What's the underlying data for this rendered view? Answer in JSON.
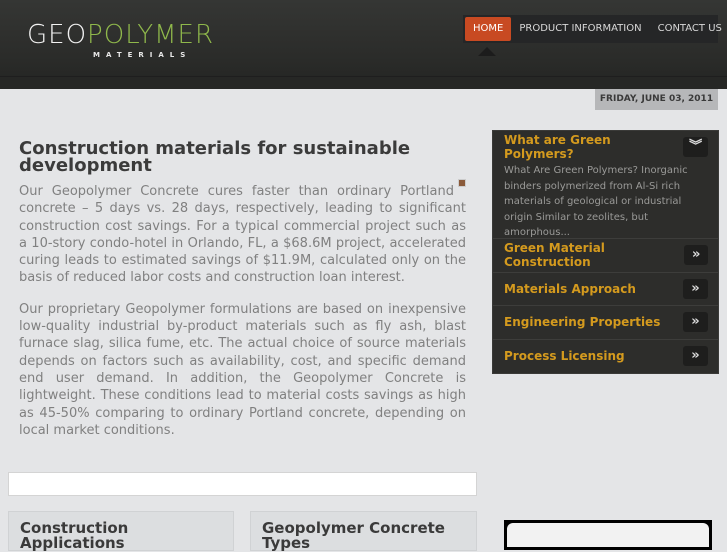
{
  "logo": {
    "geo": "GEO",
    "polymer": "POLYMER",
    "materials": "MATERIALS"
  },
  "nav": {
    "items": [
      "HOME",
      "PRODUCT INFORMATION",
      "CONTACT US"
    ]
  },
  "date": "FRIDAY, JUNE 03, 2011",
  "main": {
    "title": "Construction materials for sustainable development",
    "p1": "Our Geopolymer Concrete cures faster than ordinary Portland concrete – 5 days vs. 28 days, respectively, leading to significant construction cost savings. For a typical commercial project such as a 10-story condo-hotel in Orlando, FL, a $68.6M project, accelerated curing leads to estimated savings of $11.9M, calculated only on the basis of reduced labor costs and construction loan interest.",
    "p2": "Our proprietary Geopolymer formulations are based on inexpensive low-quality industrial by-product materials such as fly ash, blast furnace slag, silica fume, etc. The actual choice of source materials depends on factors such as availability, cost, and specific demand end user demand. In addition, the Geopolymer Concrete is lightweight. These conditions lead to material costs savings as high as 45-50% comparing to ordinary Portland concrete, depending on local market conditions."
  },
  "boxes": [
    "Construction Applications",
    "Geopolymer Concrete Types"
  ],
  "sidebar": {
    "open": {
      "title": "What are Green Polymers?",
      "text": "What Are Green Polymers? Inorganic binders polymerized from Al-Si rich materials of geological or industrial origin Similar to zeolites, but amorphous..."
    },
    "items": [
      "Green Material Construction",
      "Materials Approach",
      "Engineering Properties",
      "Process Licensing"
    ]
  }
}
